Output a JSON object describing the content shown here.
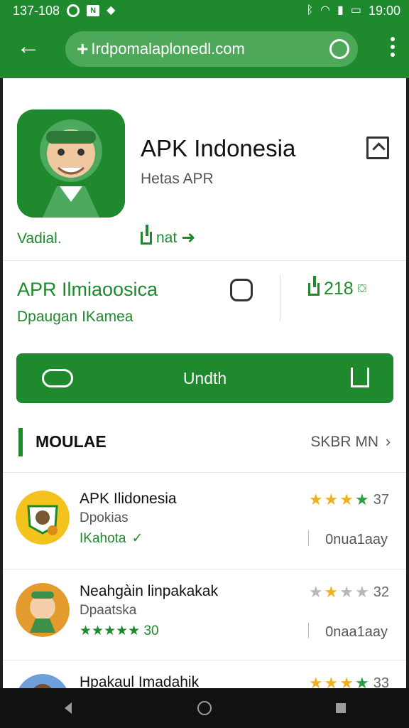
{
  "status": {
    "time_left": "137-108",
    "time_right": "19:00",
    "left_box": "N"
  },
  "browser": {
    "url": "Irdpomalaplonedl.com"
  },
  "app": {
    "name": "APK Indonesia",
    "developer": "Hetas APR",
    "verified_label": "Vadial.",
    "share_label": "nat",
    "info_title": "APR Ilmiaoosica",
    "info_subtitle": "Dpaugan IKamea",
    "count": "218",
    "download_label": "Undth"
  },
  "section": {
    "title": "MOULAE",
    "more_label": "SKBR MN"
  },
  "list": [
    {
      "title": "APK Ilidonesia",
      "subtitle": "Dpokias",
      "tag": "IKahota",
      "score": "37",
      "meta": "0nua1aay",
      "stars": [
        "on",
        "on",
        "on",
        "green"
      ]
    },
    {
      "title": "Neahgàin linpakakak",
      "subtitle": "Dpaatska",
      "tag": "★★★★★ 30",
      "score": "32",
      "meta": "0naa1aay",
      "stars": [
        "off",
        "on",
        "off",
        "off"
      ]
    },
    {
      "title": "Hpakaul Imadahik",
      "subtitle": "",
      "tag": "",
      "score": "33",
      "meta": "",
      "stars": [
        "on",
        "on",
        "on",
        "green"
      ]
    }
  ],
  "colors": {
    "accent": "#1e8a2d",
    "star_on": "#f2b01e",
    "star_green": "#2f9c44"
  }
}
